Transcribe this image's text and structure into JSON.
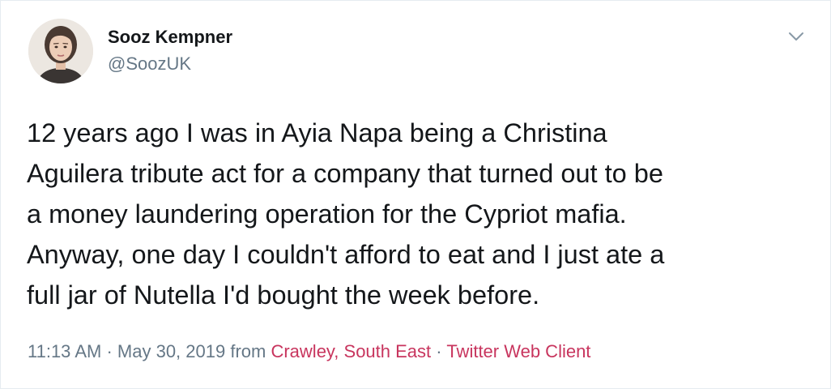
{
  "author": {
    "name": "Sooz Kempner",
    "handle": "@SoozUK"
  },
  "icons": {
    "menu": "chevron-down-icon",
    "avatar": "profile-photo"
  },
  "tweet": {
    "lines": [
      "12 years ago I was in Ayia Napa being a Christina",
      "Aguilera tribute act for a company that turned out to be",
      "a money laundering operation for the Cypriot mafia.",
      "Anyway, one day I couldn't afford to eat and I just ate a",
      "full jar of Nutella I'd bought the week before."
    ]
  },
  "meta": {
    "time": "11:13 AM",
    "separator": "·",
    "date": "May 30, 2019",
    "from_label": "from",
    "location": "Crawley, South East",
    "client": "Twitter Web Client"
  },
  "colors": {
    "text": "#14171a",
    "muted": "#657786",
    "link": "#c8355e",
    "border": "#e6ecf0"
  }
}
